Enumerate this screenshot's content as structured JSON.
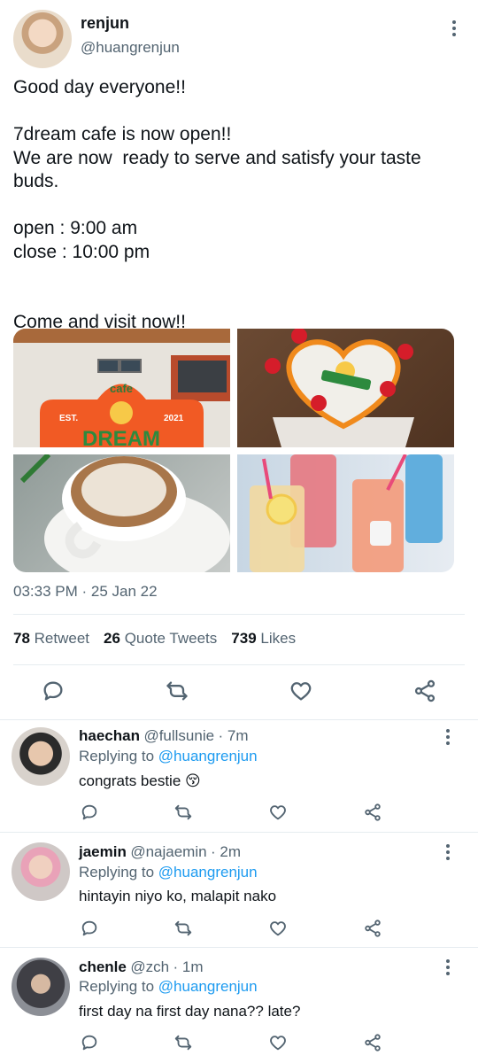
{
  "tweet": {
    "name": "renjun",
    "handle": "@huangrenjun",
    "text": "Good day everyone!!\n\n7dream cafe is now open!!\nWe are now  ready to serve and satisfy your taste buds.\n\nopen : 9:00 am\nclose : 10:00 pm\n\n\nCome and visit now!!",
    "timestamp": "03:33 PM · 25 Jan 22",
    "stats": {
      "retweets": "78",
      "retweets_label": "Retweet",
      "quotes": "26",
      "quotes_label": "Quote Tweets",
      "likes": "739",
      "likes_label": "Likes"
    },
    "media_labels": {
      "sign_cafe": "cafe",
      "sign_est": "EST.",
      "sign_year": "2021",
      "sign_dream": "DREAM"
    }
  },
  "replies": [
    {
      "name": "haechan",
      "handle": "@fullsunie",
      "time": "· 7m",
      "replying_prefix": "Replying to",
      "replying_to": "@huangrenjun",
      "text": "congrats bestie 😚"
    },
    {
      "name": "jaemin",
      "handle": "@najaemin",
      "time": "· 2m",
      "replying_prefix": "Replying to",
      "replying_to": "@huangrenjun",
      "text": "hintayin niyo ko, malapit nako"
    },
    {
      "name": "chenle",
      "handle": "@zch",
      "time": "· 1m",
      "replying_prefix": "Replying to",
      "replying_to": "@huangrenjun",
      "text": "first day na first day nana?? late?"
    }
  ],
  "icons": {
    "reply": "reply-icon",
    "retweet": "retweet-icon",
    "like": "heart-icon",
    "share": "share-icon",
    "more": "more-icon"
  },
  "colors": {
    "link": "#1d9bf0",
    "secondary": "#536471",
    "text": "#0f1419"
  }
}
